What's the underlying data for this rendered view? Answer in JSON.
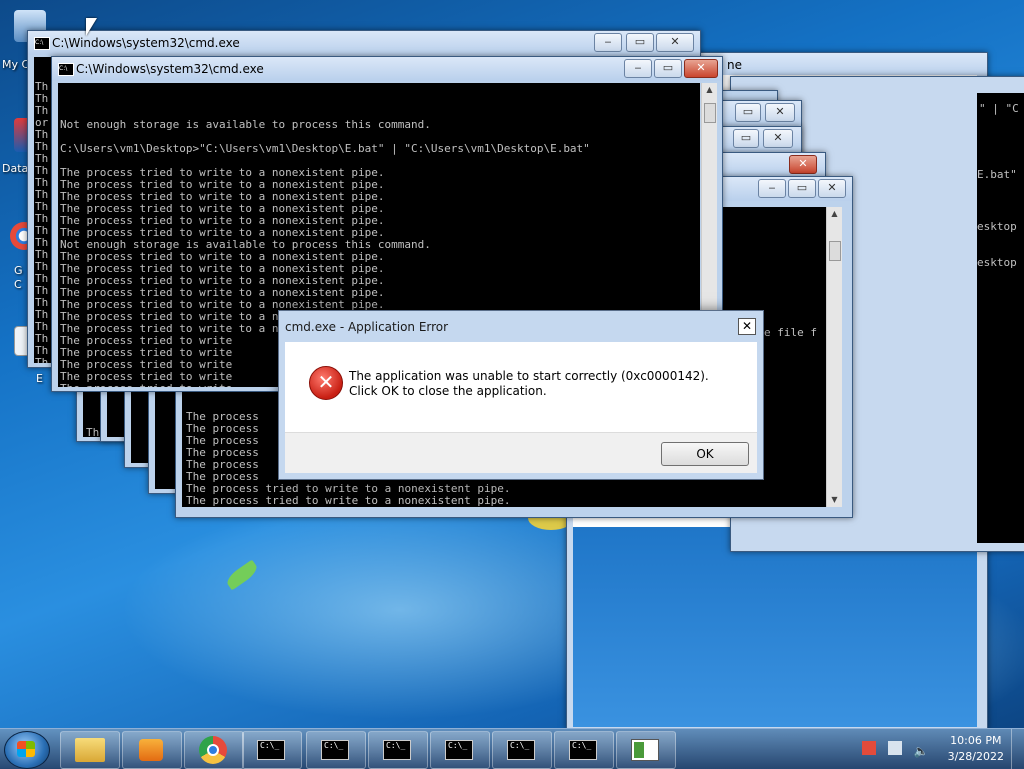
{
  "desktop": {
    "icons": [
      {
        "label": "My C",
        "icon": "computer-icon"
      },
      {
        "label": "Data",
        "icon": "data-icon"
      },
      {
        "label": "G\nC",
        "icon": "google-chrome-icon"
      },
      {
        "label": "E",
        "icon": "file-icon"
      }
    ]
  },
  "back_window": {
    "title": "C:\\Windows\\system32\\cmd.exe",
    "lines": [
      "Th",
      "Th",
      "Th",
      "or",
      "Th",
      "Th",
      "Th",
      "Th",
      "Th",
      "Th",
      "Th",
      "Th",
      "Th",
      "Th",
      "Th",
      "Th",
      "Th",
      "Th",
      "Th",
      "Th",
      "Th",
      "Th",
      "Th",
      "Th"
    ]
  },
  "main_window": {
    "title": "C:\\Windows\\system32\\cmd.exe",
    "lines": [
      "Not enough storage is available to process this command.",
      "",
      "C:\\Users\\vm1\\Desktop>\"C:\\Users\\vm1\\Desktop\\E.bat\" | \"C:\\Users\\vm1\\Desktop\\E.bat\"",
      "",
      "The process tried to write to a nonexistent pipe.",
      "The process tried to write to a nonexistent pipe.",
      "The process tried to write to a nonexistent pipe.",
      "The process tried to write to a nonexistent pipe.",
      "The process tried to write to a nonexistent pipe.",
      "The process tried to write to a nonexistent pipe.",
      "Not enough storage is available to process this command.",
      "The process tried to write to a nonexistent pipe.",
      "The process tried to write to a nonexistent pipe.",
      "The process tried to write to a nonexistent pipe.",
      "The process tried to write to a nonexistent pipe.",
      "The process tried to write to a nonexistent pipe.",
      "The process tried to write to a nonexistent pipe.",
      "The process tried to write to a nonexistent pipe.",
      "The process tried to write",
      "The process tried to write",
      "The process tried to write",
      "The process tried to write",
      "The process tried to write"
    ]
  },
  "small_windows": {
    "w1_lines": [
      "Th",
      "Th",
      "Th"
    ],
    "w2_lines": []
  },
  "front_console": {
    "lines": [
      "The process",
      "The process",
      "The process",
      "The process",
      "The process",
      "The process",
      "The process tried to write to a nonexistent pipe.",
      "The process tried to write to a nonexistent pipe."
    ]
  },
  "right_windows": {
    "menu_fragment": "ne",
    "text_a": "\" | \"C",
    "text_b": "E.bat\"",
    "text_c": "esktop",
    "text_d": "esktop",
    "text_e": "e file f"
  },
  "dialog": {
    "title": "cmd.exe - Application Error",
    "close_glyph": "✕",
    "error_glyph": "✕",
    "message": "The application was unable to start correctly (0xc0000142). Click OK to close the application.",
    "ok_label": "OK"
  },
  "taskbar": {
    "cmd_button_label": "C:\\_",
    "time": "10:06 PM",
    "date": "3/28/2022"
  },
  "colors": {
    "console_bg": "#000000",
    "console_text": "#c0c0c0",
    "titlebar": "#c7d9ef",
    "close_button": "#c9452e",
    "error_red": "#c81f13"
  }
}
